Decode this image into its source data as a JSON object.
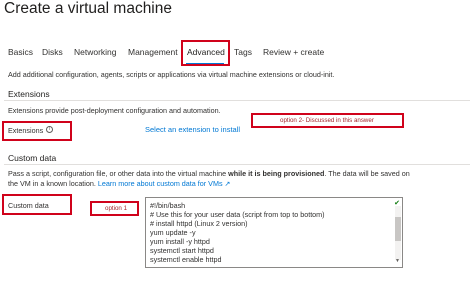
{
  "page": {
    "title": "Create a virtual machine",
    "more": "···"
  },
  "tabs": [
    "Basics",
    "Disks",
    "Networking",
    "Management",
    "Advanced",
    "Tags",
    "Review + create"
  ],
  "intro": "Add additional configuration, agents, scripts or applications via virtual machine extensions or cloud-init.",
  "extensions": {
    "title": "Extensions",
    "description": "Extensions provide post-deployment configuration and automation.",
    "label": "Extensions",
    "info_icon": "info-icon",
    "link": "Select an extension to install",
    "annotation": "option 2- Discussed in this answer"
  },
  "custom_data": {
    "title": "Custom data",
    "desc_line1_pre": "Pass a script, configuration file, or other data into the virtual machine ",
    "desc_line1_bold": "while it is being provisioned",
    "desc_line1_post": ". The data will be saved on",
    "desc_line2_pre": "the VM in a known location. ",
    "learn_more": "Learn more about custom data for VMs",
    "external_icon": "external-link-icon",
    "label": "Custom data",
    "annotation": "option 1",
    "lines": [
      "#!/bin/bash",
      "# Use this for your user data (script from top to bottom)",
      "# install httpd (Linux 2 version)",
      "yum update -y",
      "yum install -y httpd",
      "systemctl start httpd",
      "systemctl enable httpd"
    ]
  },
  "colors": {
    "accent": "#0078d4",
    "annotation_red": "#d0021b"
  }
}
